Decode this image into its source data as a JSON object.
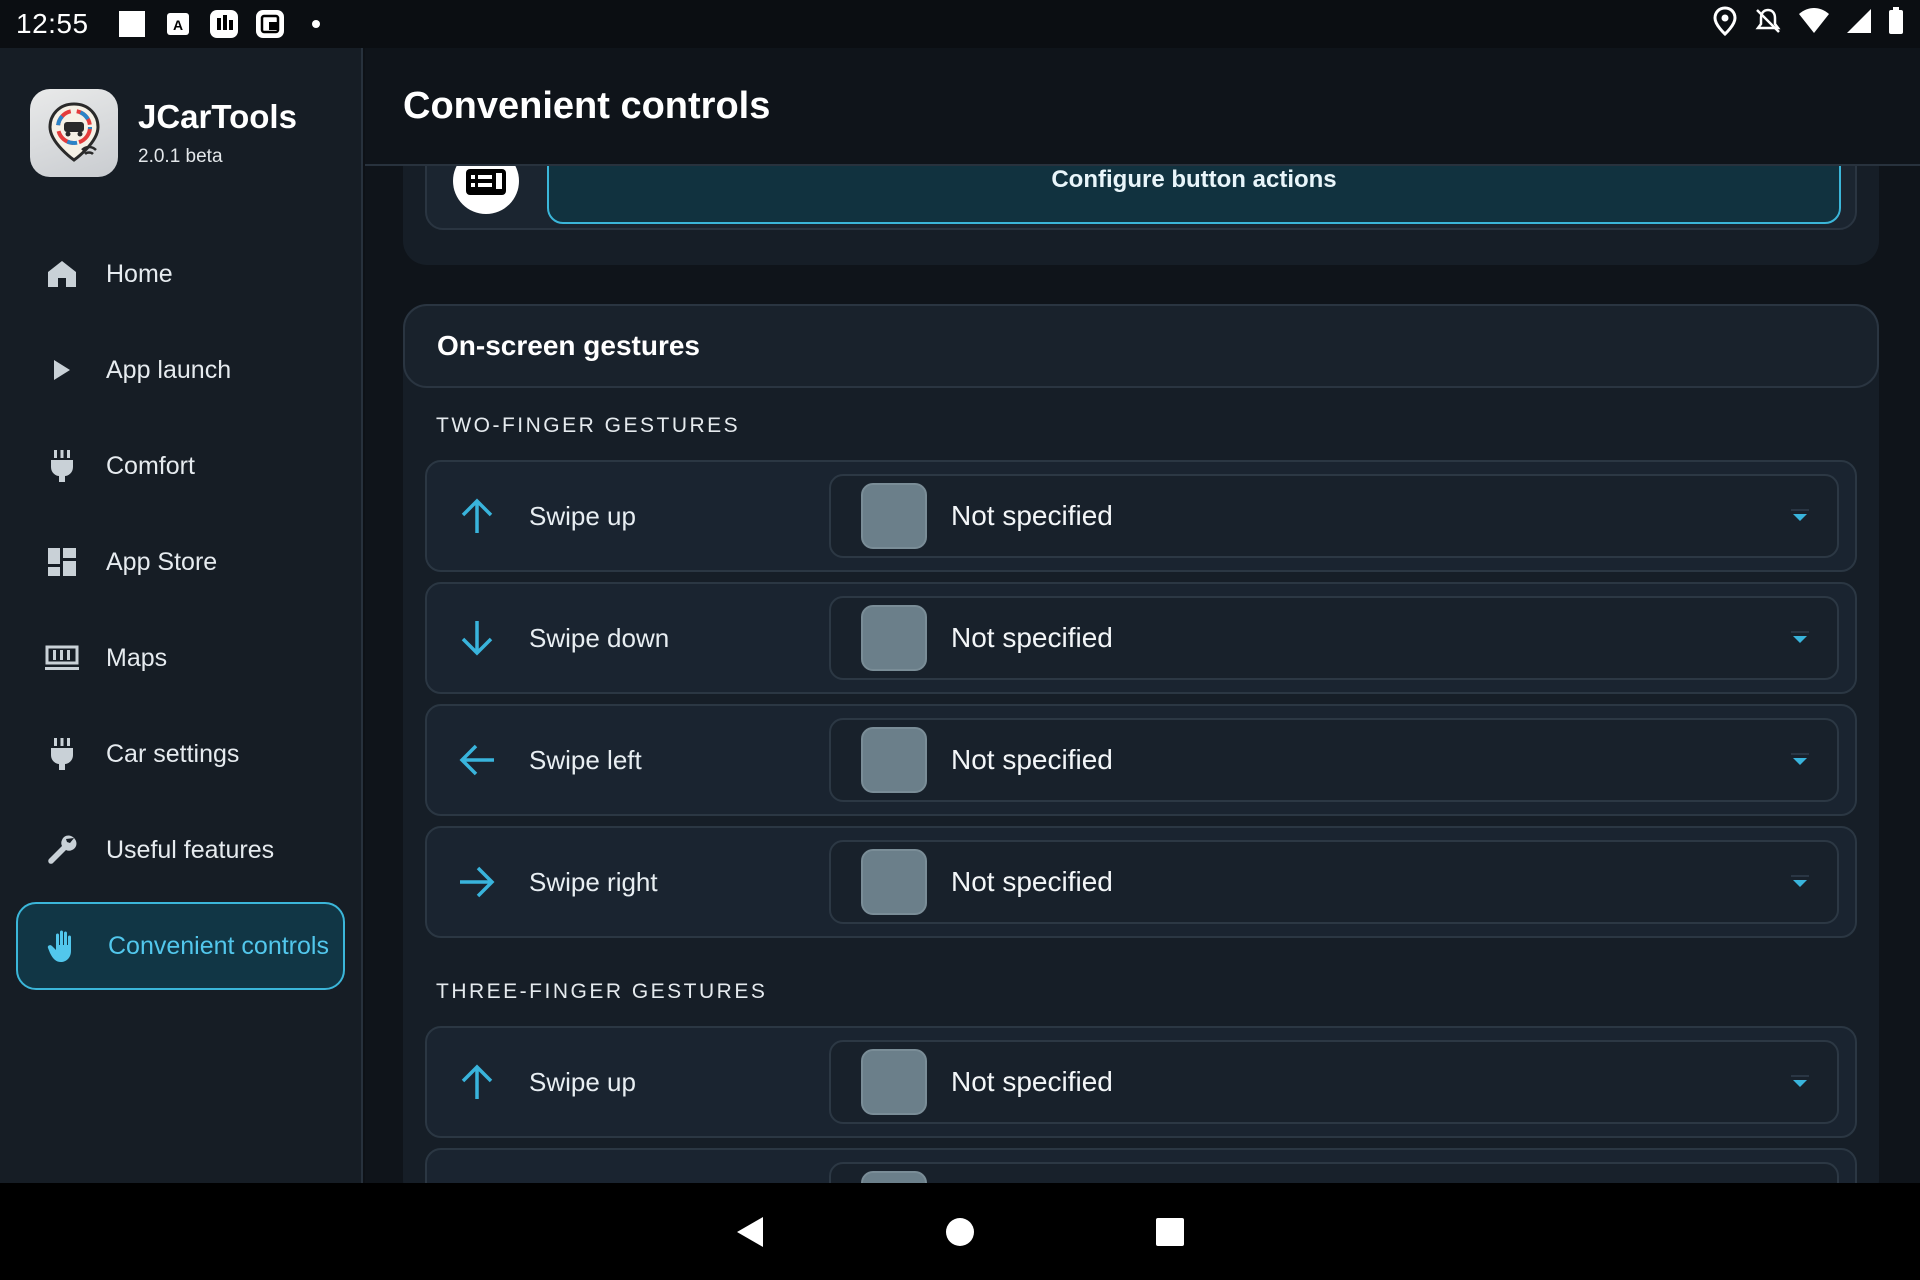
{
  "status_bar": {
    "time": "12:55"
  },
  "app": {
    "name": "JCarTools",
    "version": "2.0.1 beta"
  },
  "sidebar": {
    "items": [
      {
        "label": "Home",
        "icon": "home-icon"
      },
      {
        "label": "App launch",
        "icon": "play-icon"
      },
      {
        "label": "Comfort",
        "icon": "plug-icon"
      },
      {
        "label": "App Store",
        "icon": "dashboard-icon"
      },
      {
        "label": "Maps",
        "icon": "map-icon"
      },
      {
        "label": "Car settings",
        "icon": "plug-icon"
      },
      {
        "label": "Useful features",
        "icon": "wrench-icon"
      },
      {
        "label": "Convenient controls",
        "icon": "hand-icon",
        "active": true
      }
    ]
  },
  "header": {
    "title": "Convenient controls"
  },
  "previous_section": {
    "button_label": "Configure button actions"
  },
  "gestures": {
    "title": "On-screen gestures",
    "two_finger": {
      "label": "TWO-FINGER GESTURES",
      "rows": [
        {
          "label": "Swipe up",
          "value": "Not specified",
          "icon": "arrow-up-icon"
        },
        {
          "label": "Swipe down",
          "value": "Not specified",
          "icon": "arrow-down-icon"
        },
        {
          "label": "Swipe left",
          "value": "Not specified",
          "icon": "arrow-left-icon"
        },
        {
          "label": "Swipe right",
          "value": "Not specified",
          "icon": "arrow-right-icon"
        }
      ]
    },
    "three_finger": {
      "label": "THREE-FINGER GESTURES",
      "rows": [
        {
          "label": "Swipe up",
          "value": "Not specified",
          "icon": "arrow-up-icon"
        }
      ]
    }
  },
  "colors": {
    "accent": "#3bb6d9",
    "swatch": "#6b7f8a"
  }
}
